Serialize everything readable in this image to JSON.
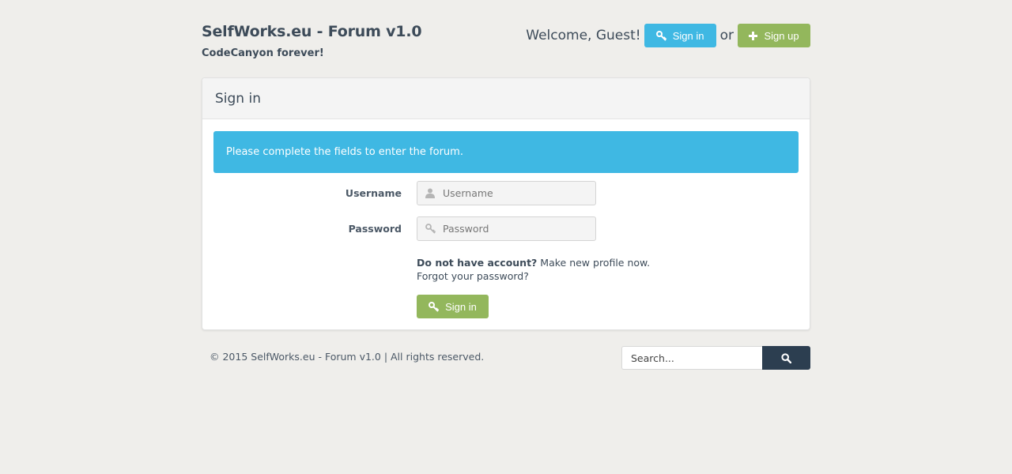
{
  "header": {
    "site_title": "SelfWorks.eu - Forum v1.0",
    "tagline": "CodeCanyon forever!",
    "welcome": "Welcome, Guest!",
    "signin_label": "Sign in",
    "or_text": "or",
    "signup_label": "Sign up"
  },
  "panel": {
    "title": "Sign in",
    "alert": "Please complete the fields to enter the forum.",
    "username_label": "Username",
    "username_placeholder": "Username",
    "password_label": "Password",
    "password_placeholder": "Password",
    "no_account": "Do not have account?",
    "make_profile": "Make new profile now.",
    "forgot": "Forgot your password?",
    "submit_label": "Sign in"
  },
  "footer": {
    "copyright": "© 2015 SelfWorks.eu - Forum v1.0 | All rights reserved.",
    "search_placeholder": "Search..."
  },
  "icons": {
    "signin": "key-icon",
    "signup": "plus-icon",
    "username": "user-icon",
    "password": "key-icon",
    "search": "search-icon"
  },
  "colors": {
    "accent_blue": "#3fb8e3",
    "accent_green": "#93b75c",
    "dark": "#2c3e50",
    "background": "#efeeeb"
  }
}
